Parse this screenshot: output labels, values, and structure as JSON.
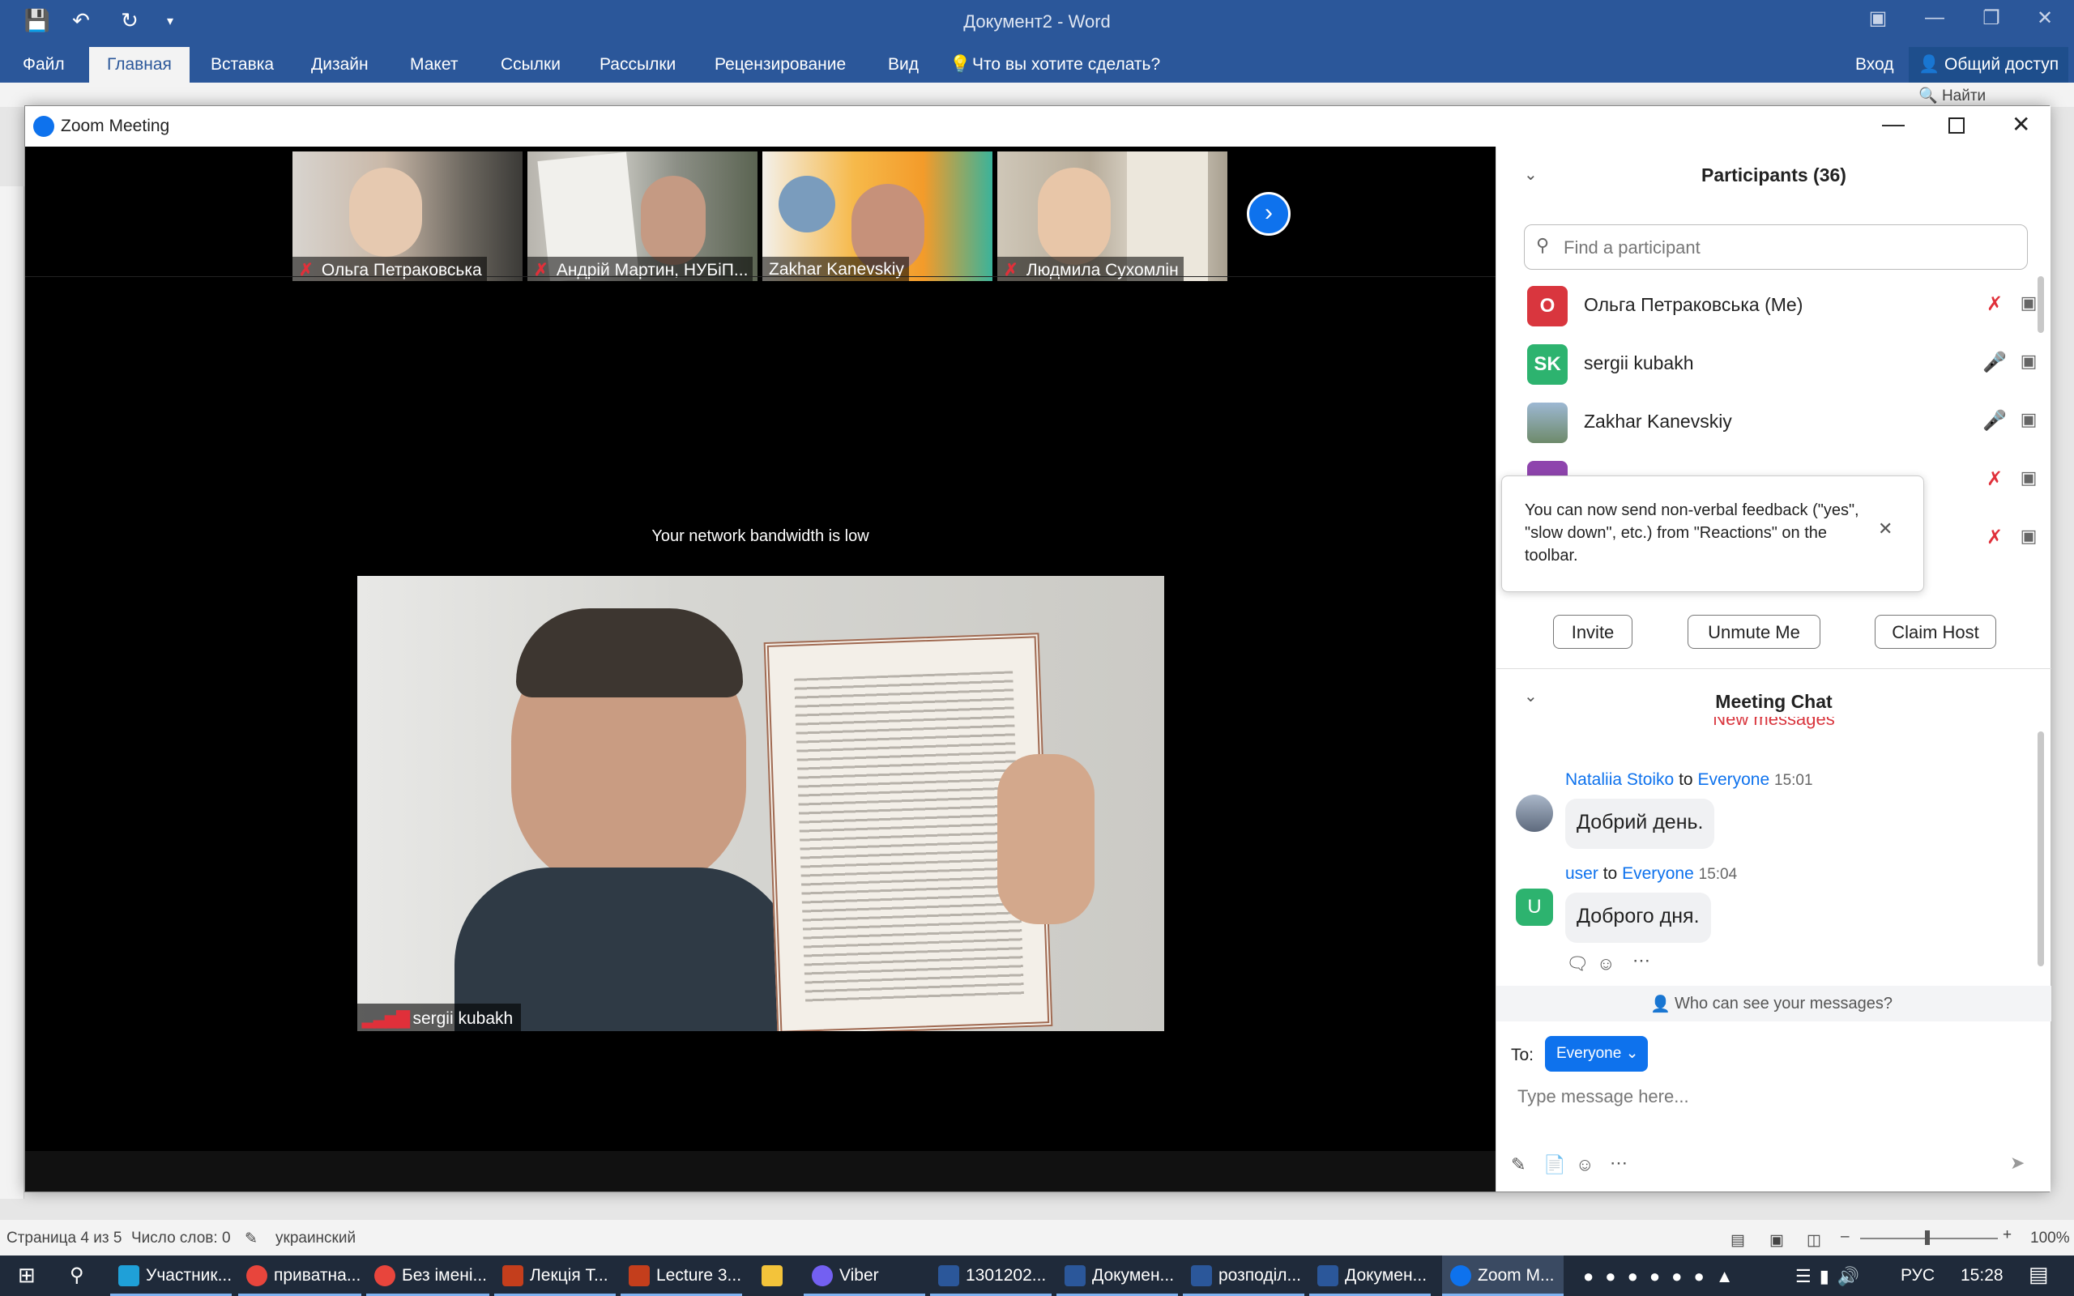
{
  "word": {
    "title": "Документ2 - Word",
    "menu": [
      "Файл",
      "Главная",
      "Вставка",
      "Дизайн",
      "Макет",
      "Ссылки",
      "Рассылки",
      "Рецензирование",
      "Вид"
    ],
    "tell_me": "Что вы хотите сделать?",
    "signin": "Вход",
    "share": "Общий доступ",
    "find": "Найти",
    "status": {
      "page": "Страница 4 из 5",
      "words": "Число слов: 0",
      "language": "украинский",
      "zoom": "100%"
    }
  },
  "zoom": {
    "title": "Zoom Meeting",
    "bandwidth_msg": "Your network bandwidth is low",
    "active_speaker": "sergii kubakh",
    "thumbnails": [
      {
        "name": "Ольга Петраковська",
        "muted": true
      },
      {
        "name": "Андрій Мартин, НУБіП...",
        "muted": true
      },
      {
        "name": "Zakhar Kanevskiy",
        "muted": false
      },
      {
        "name": "Людмила Сухомлін",
        "muted": true
      }
    ],
    "participants": {
      "header": "Participants (36)",
      "search_placeholder": "Find a participant",
      "list": [
        {
          "initials": "О",
          "name": "Ольга Петраковська (Me)",
          "avatar_color": "#d9363e",
          "muted": true
        },
        {
          "initials": "SK",
          "name": "sergii kubakh",
          "avatar_color": "#2db36f",
          "muted": false
        },
        {
          "initials": "",
          "name": "Zakhar Kanevskiy",
          "avatar_color": "#8aa7c4",
          "muted": false
        }
      ],
      "tooltip": "You can now send non-verbal feedback (\"yes\", \"slow down\", etc.) from \"Reactions\" on the toolbar.",
      "buttons": {
        "invite": "Invite",
        "unmute": "Unmute Me",
        "claim_host": "Claim Host"
      }
    },
    "chat": {
      "header": "Meeting Chat",
      "new_messages": "New messages",
      "messages": [
        {
          "sender": "Nataliia Stoiko",
          "to_word": "to",
          "recipient": "Everyone",
          "time": "15:01",
          "text": "Добрий день."
        },
        {
          "sender": "user",
          "to_word": "to",
          "recipient": "Everyone",
          "time": "15:04",
          "text": "Доброго дня.",
          "avatar": "U"
        }
      ],
      "privacy": "Who can see your messages?",
      "to_label": "To:",
      "to_value": "Everyone",
      "input_placeholder": "Type message here..."
    }
  },
  "taskbar": {
    "items": [
      "Участник...",
      "приватна...",
      "Без імені...",
      "Лекція Т...",
      "Lecture 3...",
      "",
      "Viber",
      "1301202...",
      "Докумен...",
      "розподіл...",
      "Докумен...",
      "Zoom M..."
    ],
    "lang": "РУС",
    "time": "15:28"
  },
  "colors": {
    "word_blue": "#2b579a",
    "zoom_blue": "#0e72ed",
    "muted_red": "#e0303a"
  }
}
